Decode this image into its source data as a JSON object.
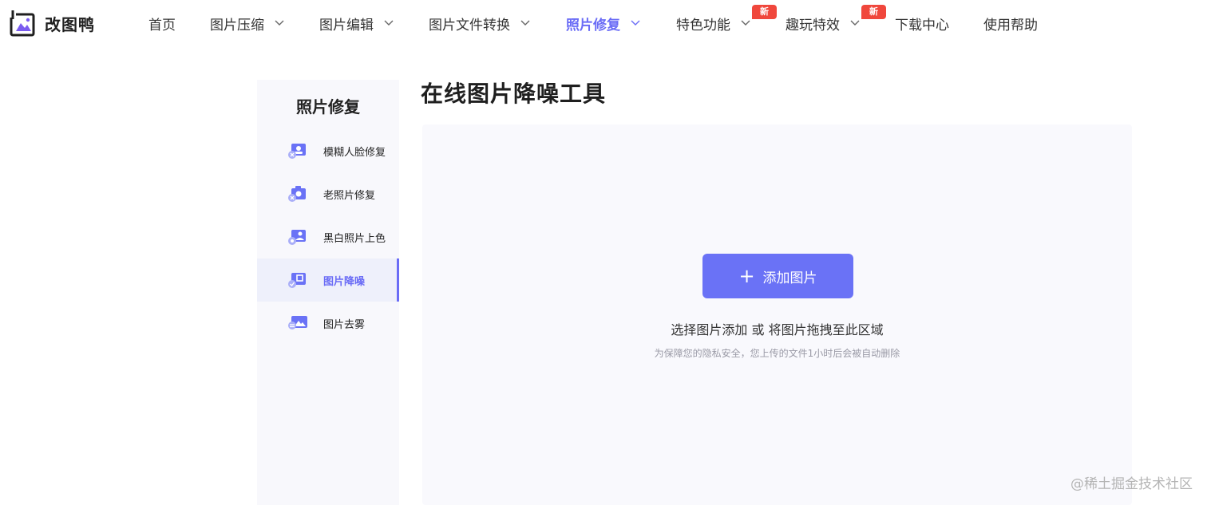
{
  "brand": {
    "name": "改图鸭"
  },
  "nav": {
    "items": [
      {
        "label": "首页",
        "dropdown": false
      },
      {
        "label": "图片压缩",
        "dropdown": true
      },
      {
        "label": "图片编辑",
        "dropdown": true
      },
      {
        "label": "图片文件转换",
        "dropdown": true
      },
      {
        "label": "照片修复",
        "dropdown": true,
        "active": true
      },
      {
        "label": "特色功能",
        "dropdown": true,
        "badge": "新"
      },
      {
        "label": "趣玩特效",
        "dropdown": true,
        "badge": "新"
      },
      {
        "label": "下载中心",
        "dropdown": false
      },
      {
        "label": "使用帮助",
        "dropdown": false
      }
    ]
  },
  "sidebar": {
    "title": "照片修复",
    "items": [
      {
        "label": "模糊人脸修复",
        "icon": "face-restore-icon"
      },
      {
        "label": "老照片修复",
        "icon": "old-photo-icon"
      },
      {
        "label": "黑白照片上色",
        "icon": "colorize-icon"
      },
      {
        "label": "图片降噪",
        "icon": "denoise-icon",
        "active": true
      },
      {
        "label": "图片去雾",
        "icon": "dehaze-icon"
      }
    ]
  },
  "main": {
    "title": "在线图片降噪工具",
    "upload_button": "添加图片",
    "hint_part1": "选择图片添加",
    "hint_or": "或",
    "hint_part2": "将图片拖拽至此区域",
    "privacy": "为保障您的隐私安全，您上传的文件1小时后会被自动删除"
  },
  "watermark": "@稀土掘金技术社区",
  "colors": {
    "accent": "#6a6cf6",
    "badge": "#f0473c",
    "button": "#6a72f6"
  }
}
